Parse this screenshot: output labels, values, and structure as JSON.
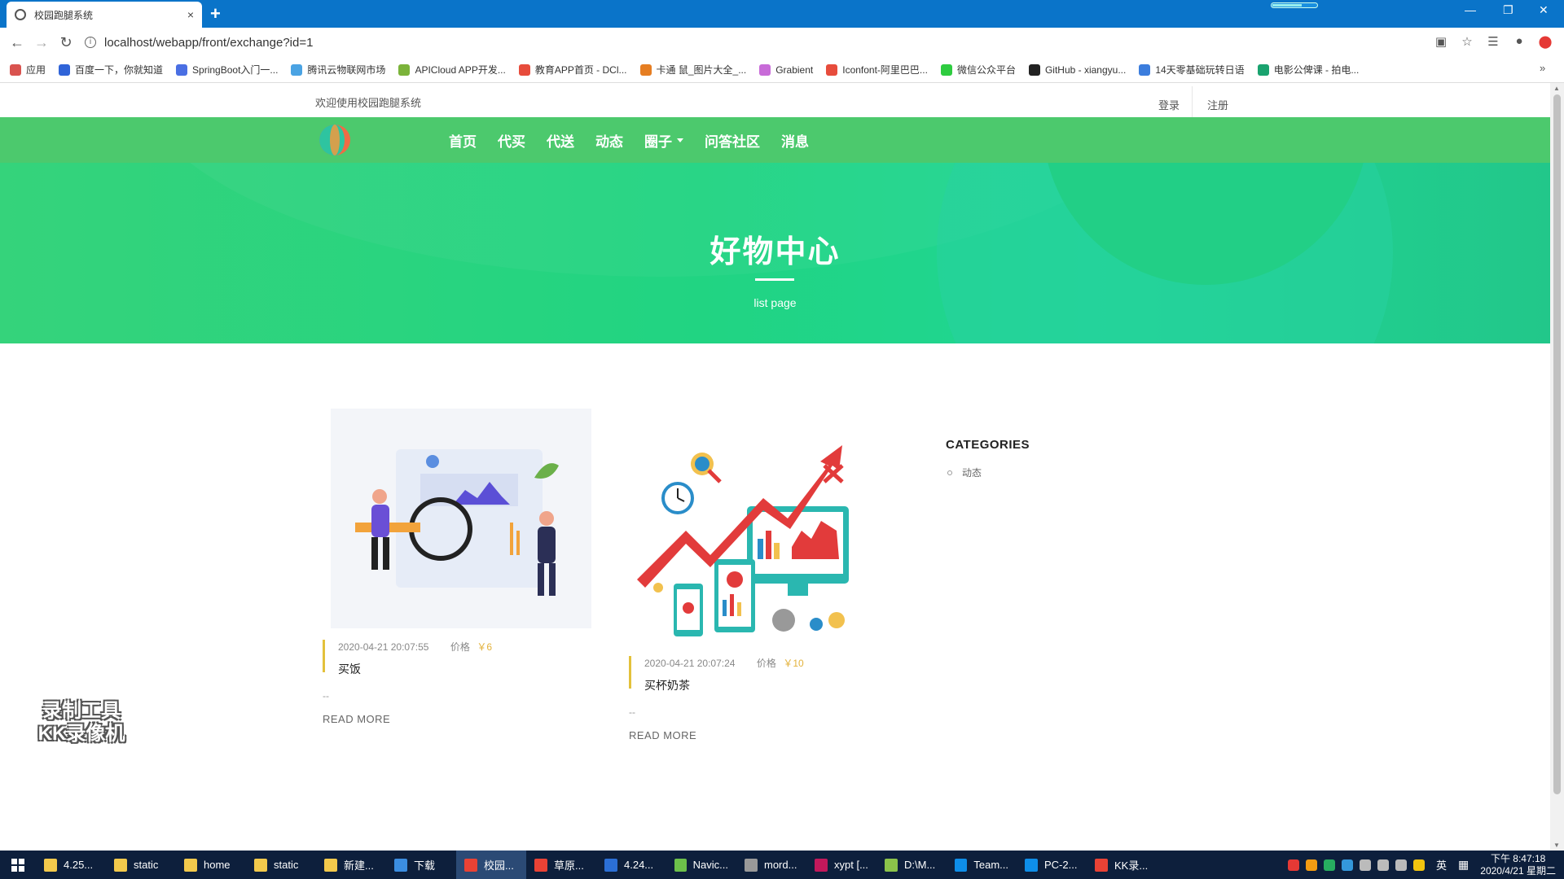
{
  "browser": {
    "tab_title": "校园跑腿系统",
    "url": "localhost/webapp/front/exchange?id=1",
    "new_tab": "+",
    "close_tab": "×",
    "bookmarks": [
      {
        "label": "应用",
        "color": "#d9534f"
      },
      {
        "label": "百度一下，你就知道",
        "color": "#3064d8"
      },
      {
        "label": "SpringBoot入门一...",
        "color": "#4a6fe3"
      },
      {
        "label": "腾讯云物联网市场",
        "color": "#4aa3e3"
      },
      {
        "label": "APICloud APP开发...",
        "color": "#7bb33a"
      },
      {
        "label": "教育APP首页 - DCl...",
        "color": "#e74c3c"
      },
      {
        "label": "卡通 鼠_图片大全_...",
        "color": "#e67e22"
      },
      {
        "label": "Grabient",
        "color": "#c86bd8"
      },
      {
        "label": "Iconfont-阿里巴巴...",
        "color": "#e74c3c"
      },
      {
        "label": "微信公众平台",
        "color": "#2ecc40"
      },
      {
        "label": "GitHub - xiangyu...",
        "color": "#222222"
      },
      {
        "label": "14天零基础玩转日语",
        "color": "#3b7ddd"
      },
      {
        "label": "电影公俾课 - 拍电...",
        "color": "#1aa36f"
      }
    ],
    "more_bookmarks": "»"
  },
  "header": {
    "welcome": "欢迎使用校园跑腿系统",
    "login": "登录",
    "register": "注册"
  },
  "nav": {
    "items": [
      "首页",
      "代买",
      "代送",
      "动态",
      "圈子",
      "问答社区",
      "消息"
    ]
  },
  "hero": {
    "title": "好物中心",
    "subtitle": "list page"
  },
  "posts": [
    {
      "date": "2020-04-21 20:07:55",
      "price_label": "价格",
      "price": "￥6",
      "title": "买饭",
      "excerpt": "--",
      "more": "READ MORE"
    },
    {
      "date": "2020-04-21 20:07:24",
      "price_label": "价格",
      "price": "￥10",
      "title": "买杯奶茶",
      "excerpt": "--",
      "more": "READ MORE"
    }
  ],
  "sidebar": {
    "title": "CATEGORIES",
    "items": [
      "动态"
    ]
  },
  "watermark": {
    "line1": "录制工具",
    "line2": "KK录像机"
  },
  "taskbar": {
    "items": [
      {
        "label": "4.25...",
        "color": "#f2c94c"
      },
      {
        "label": "static",
        "color": "#f2c94c"
      },
      {
        "label": "home",
        "color": "#f2c94c"
      },
      {
        "label": "static",
        "color": "#f2c94c"
      },
      {
        "label": "新建...",
        "color": "#f2c94c"
      },
      {
        "label": "下载",
        "color": "#3b8de0"
      },
      {
        "label": "校园...",
        "color": "#e94235"
      },
      {
        "label": "草原...",
        "color": "#e94235"
      },
      {
        "label": "4.24...",
        "color": "#2b6fd6"
      },
      {
        "label": "Navic...",
        "color": "#6cc04a"
      },
      {
        "label": "mord...",
        "color": "#999999"
      },
      {
        "label": "xypt [...",
        "color": "#c2185b"
      },
      {
        "label": "D:\\M...",
        "color": "#8bc34a"
      },
      {
        "label": "Team...",
        "color": "#0e8ee9"
      },
      {
        "label": "PC-2...",
        "color": "#0e8ee9"
      },
      {
        "label": "KK录...",
        "color": "#e94235"
      }
    ],
    "ime": "英",
    "time": "下午 8:47:18",
    "date": "2020/4/21 星期二"
  }
}
